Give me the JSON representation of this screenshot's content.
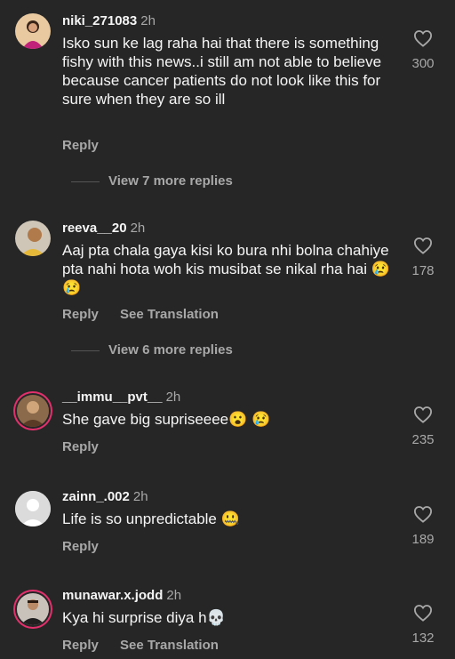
{
  "colors": {
    "background": "#262626",
    "text": "#f5f5f5",
    "muted": "#a8a8a8",
    "story_ring": "#e1306c"
  },
  "comments": [
    {
      "username": "niki_271083",
      "time": "2h",
      "text": "Isko sun ke lag raha hai that there is something fishy with this news..i still am not able to believe because cancer patients do not look like this for sure when they are so ill",
      "actions": [
        "Reply"
      ],
      "likes": "300",
      "view_replies": "View 7 more replies",
      "avatar_icon": "avatar-image"
    },
    {
      "username": "reeva__20",
      "time": "2h",
      "text": "Aaj pta chala gaya kisi ko bura nhi bolna chahiye pta nahi hota woh kis musibat se nikal rha hai 😢 😢",
      "actions": [
        "Reply",
        "See Translation"
      ],
      "likes": "178",
      "view_replies": "View 6 more replies",
      "avatar_icon": "avatar-image"
    },
    {
      "username": "__immu__pvt__",
      "time": "2h",
      "text": "She gave big supriseeee😮 😢",
      "actions": [
        "Reply"
      ],
      "likes": "235",
      "avatar_icon": "avatar-image"
    },
    {
      "username": "zainn_.002",
      "time": "2h",
      "text": "Life is so unpredictable 🤐",
      "actions": [
        "Reply"
      ],
      "likes": "189",
      "avatar_icon": "default-avatar-icon"
    },
    {
      "username": "munawar.x.jodd",
      "time": "2h",
      "text": "Kya hi surprise diya h💀",
      "actions": [
        "Reply",
        "See Translation"
      ],
      "likes": "132",
      "avatar_icon": "avatar-image"
    }
  ]
}
